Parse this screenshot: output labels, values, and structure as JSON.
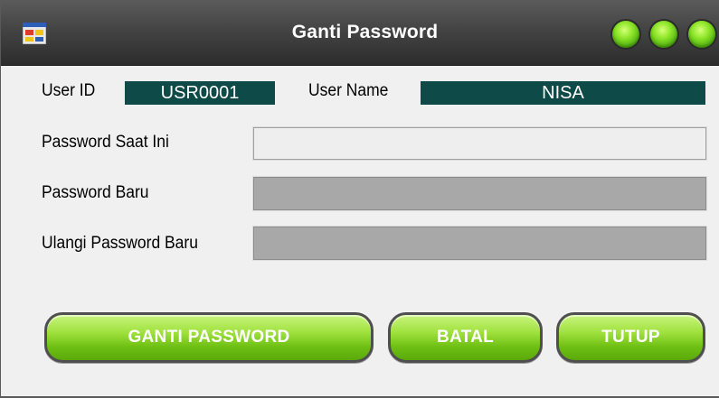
{
  "window": {
    "title": "Ganti Password"
  },
  "form": {
    "user_id_label": "User ID",
    "user_id_value": "USR0001",
    "user_name_label": "User Name",
    "user_name_value": "NISA",
    "current_password_label": "Password Saat Ini",
    "current_password_value": "",
    "new_password_label": "Password Baru",
    "new_password_value": "",
    "repeat_password_label": "Ulangi Password Baru",
    "repeat_password_value": ""
  },
  "buttons": {
    "change_password": "GANTI PASSWORD",
    "cancel": "BATAL",
    "close": "TUTUP"
  },
  "colors": {
    "field_dark": "#0e4a47",
    "button_green": "#8fe62a",
    "titlebar": "#444444"
  }
}
